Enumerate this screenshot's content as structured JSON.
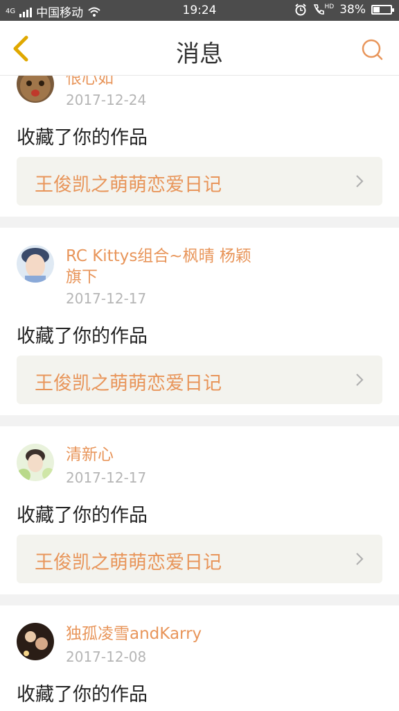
{
  "status": {
    "carrier": "中国移动",
    "network": "4G",
    "time": "19:24",
    "hd_label": "HD",
    "battery": "38%",
    "battery_level": 0.38
  },
  "header": {
    "title": "消息"
  },
  "messages": [
    {
      "user": "恨心如",
      "date": "2017-12-24",
      "action": "收藏了你的作品",
      "work": "王俊凯之萌萌恋爱日记"
    },
    {
      "user": "RC Kittys组合~枫晴 杨颖旗下",
      "date": "2017-12-17",
      "action": "收藏了你的作品",
      "work": "王俊凯之萌萌恋爱日记"
    },
    {
      "user": "清新心",
      "date": "2017-12-17",
      "action": "收藏了你的作品",
      "work": "王俊凯之萌萌恋爱日记"
    },
    {
      "user": "独孤凌雪andKarry",
      "date": "2017-12-08",
      "action": "收藏了你的作品"
    }
  ],
  "colors": {
    "accent": "#e8955a",
    "back": "#e0a800",
    "separator": "#f2f2f2",
    "work_bg": "#f3f3ee"
  }
}
